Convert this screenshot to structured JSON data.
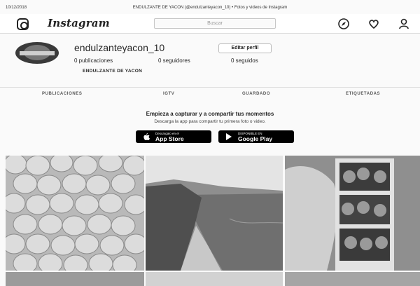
{
  "print_header": {
    "date": "10/12/2018",
    "title": "ENDULZANTE DE YACON (@endulzanteyacon_10) • Fotos y videos de Instagram"
  },
  "topbar": {
    "logo_text": "Instagram",
    "search_placeholder": "Buscar",
    "icons": [
      "instagram-camera-icon",
      "compass-icon",
      "heart-icon",
      "user-icon"
    ]
  },
  "profile": {
    "username": "endulzanteyacon_10",
    "edit_button": "Editar perfil",
    "stats": {
      "posts": "0 publicaciones",
      "followers": "0 seguidores",
      "following": "0 seguidos"
    },
    "full_name": "ENDULZANTE DE YACON"
  },
  "tabs": [
    {
      "label": "PUBLICACIONES"
    },
    {
      "label": "IGTV"
    },
    {
      "label": "GUARDADO"
    },
    {
      "label": "ETIQUETADAS"
    }
  ],
  "empty_state": {
    "headline": "Empieza a capturar y a compartir tus momentos",
    "subtext": "Descarga la app para compartir tu primera foto o video.",
    "app_store": {
      "line1": "Descargalo en el",
      "line2": "App Store"
    },
    "google_play": {
      "line1": "DISPONIBLE EN",
      "line2": "Google Play"
    }
  },
  "colors": {
    "background": "#fafafa",
    "text": "#262626",
    "border": "#dbdbdb",
    "button_black": "#000000"
  }
}
